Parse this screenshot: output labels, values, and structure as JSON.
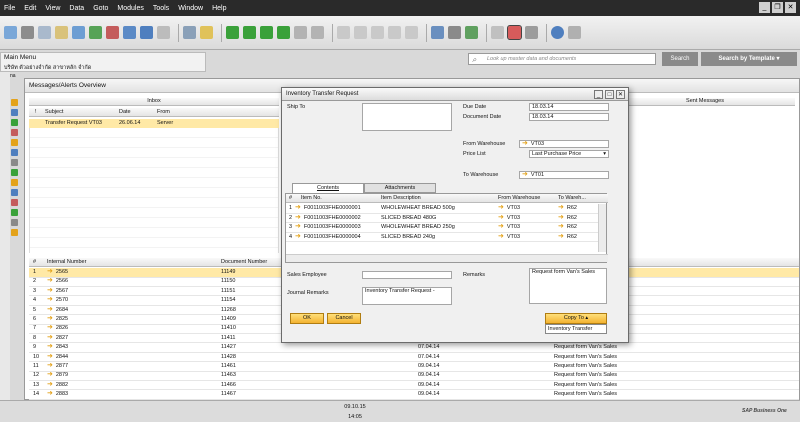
{
  "menubar": {
    "items": [
      "File",
      "Edit",
      "View",
      "Data",
      "Goto",
      "Modules",
      "Tools",
      "Window",
      "Help"
    ]
  },
  "search": {
    "placeholder": "Look up master data and documents",
    "button": "Search",
    "template_button": "Search by Template"
  },
  "main_menu": {
    "title": "Main Menu",
    "user": "บริษัท ตัวอย่างจำกัด สาขาหลัก จำกัด",
    "user_short": "mana"
  },
  "messages": {
    "title": "Messages/Alerts Overview",
    "inbox_label": "Inbox",
    "sent_label": "Sent Messages",
    "columns": [
      "!",
      "Subject",
      "Date",
      "From"
    ],
    "inbox_rows": [
      {
        "subject": "Transfer Request VT03",
        "date": "26.06.14",
        "from": "Server"
      }
    ],
    "detail_columns": [
      "#",
      "Internal Number",
      "Document Number"
    ],
    "rows": [
      {
        "n": "1",
        "internal": "2565",
        "doc": "11149",
        "date": "",
        "remark": ""
      },
      {
        "n": "2",
        "internal": "2566",
        "doc": "11150",
        "date": "",
        "remark": ""
      },
      {
        "n": "3",
        "internal": "2567",
        "doc": "11151",
        "date": "",
        "remark": ""
      },
      {
        "n": "4",
        "internal": "2570",
        "doc": "11154",
        "date": "",
        "remark": ""
      },
      {
        "n": "5",
        "internal": "2684",
        "doc": "11268",
        "date": "",
        "remark": ""
      },
      {
        "n": "6",
        "internal": "2825",
        "doc": "11409",
        "date": "",
        "remark": ""
      },
      {
        "n": "7",
        "internal": "2826",
        "doc": "11410",
        "date": "",
        "remark": ""
      },
      {
        "n": "8",
        "internal": "2827",
        "doc": "11411",
        "date": "",
        "remark": ""
      },
      {
        "n": "9",
        "internal": "2843",
        "doc": "11427",
        "date": "07.04.14",
        "remark": "Request form Van's Sales"
      },
      {
        "n": "10",
        "internal": "2844",
        "doc": "11428",
        "date": "07.04.14",
        "remark": "Request form Van's Sales"
      },
      {
        "n": "11",
        "internal": "2877",
        "doc": "11461",
        "date": "09.04.14",
        "remark": "Request form Van's Sales"
      },
      {
        "n": "12",
        "internal": "2879",
        "doc": "11463",
        "date": "09.04.14",
        "remark": "Request form Van's Sales"
      },
      {
        "n": "13",
        "internal": "2882",
        "doc": "11466",
        "date": "09.04.14",
        "remark": "Request form Van's Sales"
      },
      {
        "n": "14",
        "internal": "2883",
        "doc": "11467",
        "date": "09.04.14",
        "remark": "Request form Van's Sales"
      }
    ]
  },
  "dialog": {
    "title": "Inventory Transfer Request",
    "ship_to_label": "Ship To",
    "due_date_label": "Due Date",
    "due_date": "18.03.14",
    "doc_date_label": "Document Date",
    "doc_date": "18.03.14",
    "from_wh_label": "From Warehouse",
    "from_wh": "VT03",
    "price_list_label": "Price List",
    "price_list": "Last Purchase Price",
    "to_wh_label": "To Warehouse",
    "to_wh": "VT01",
    "tabs": [
      "Contents",
      "Attachments"
    ],
    "columns": [
      "#",
      "Item No.",
      "Item Description",
      "From Warehouse",
      "To Wareh..."
    ],
    "lines": [
      {
        "n": "1",
        "item": "F0011003FHE0000001",
        "desc": "WHOLEWHEAT  BREAD 500g",
        "from": "VT03",
        "to": "R62"
      },
      {
        "n": "2",
        "item": "F0011003FHE0000002",
        "desc": "SLICED  BREAD 480G",
        "from": "VT03",
        "to": "R62"
      },
      {
        "n": "3",
        "item": "F0011003FHE0000003",
        "desc": "WHOLEWHEAT  BREAD 250g",
        "from": "VT03",
        "to": "R62"
      },
      {
        "n": "4",
        "item": "F0011003FHE0000004",
        "desc": "SLICED  BREAD 240g",
        "from": "VT03",
        "to": "R62"
      }
    ],
    "sales_emp_label": "Sales Employee",
    "remarks_label": "Remarks",
    "remarks": "Request form Van's Sales",
    "journal_label": "Journal Remarks",
    "journal": "Inventory Transfer Request -",
    "ok": "OK",
    "cancel": "Cancel",
    "copy_to": "Copy To",
    "copy_option": "Inventory Transfer"
  },
  "status": {
    "date": "09.10.15",
    "time": "14:05",
    "logo": "SAP Business One"
  },
  "colors": {
    "accent": "#f3b331",
    "selected_row": "#ffe9a6",
    "menubar": "#2a2a2a"
  }
}
